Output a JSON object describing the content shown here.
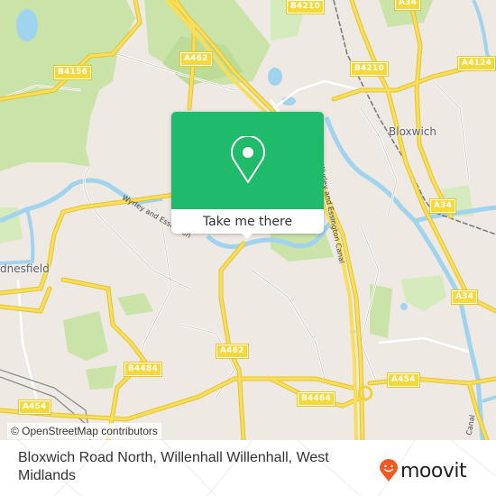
{
  "map": {
    "colors": {
      "background": "#efe9e4",
      "park": "#c9e3a8",
      "wood": "#bcdc98",
      "water": "#9fd3ee",
      "road_major": "#f5d83a",
      "road_minor": "#ffffff",
      "rail": "#777777"
    },
    "road_labels": [
      {
        "id": "b4156",
        "text": "B4156"
      },
      {
        "id": "a462-top",
        "text": "A462"
      },
      {
        "id": "b4210-top",
        "text": "B4210"
      },
      {
        "id": "a34-top",
        "text": "A34"
      },
      {
        "id": "b4210",
        "text": "B4210"
      },
      {
        "id": "a4124",
        "text": "A4124"
      },
      {
        "id": "a34-mid",
        "text": "A34"
      },
      {
        "id": "a34-low",
        "text": "A34"
      },
      {
        "id": "a462-low",
        "text": "A462"
      },
      {
        "id": "b4484",
        "text": "B4484"
      },
      {
        "id": "a454-left",
        "text": "A454"
      },
      {
        "id": "b4464",
        "text": "B4464"
      },
      {
        "id": "a454-right",
        "text": "A454"
      }
    ],
    "place_labels": [
      {
        "id": "bloxwich",
        "text": "Bloxwich"
      },
      {
        "id": "wednesfield",
        "text": "dnesfield"
      }
    ],
    "canal_labels": [
      {
        "id": "canal-left",
        "text": "Wyrley and Essington"
      },
      {
        "id": "canal-right",
        "text": "Wyrley and Essington Canal"
      },
      {
        "id": "canal-bottom",
        "text": "Canal"
      }
    ],
    "attribution": "© OpenStreetMap contributors"
  },
  "popup": {
    "icon": "map-pin-icon",
    "cta_label": "Take me there",
    "color": "#1fba6a"
  },
  "footer": {
    "address": "Bloxwich Road North, Willenhall Willenhall, West Midlands",
    "logo_text": "moovit",
    "logo_icon": "moovit-smiley-pin-icon",
    "logo_color": "#f15a22"
  }
}
